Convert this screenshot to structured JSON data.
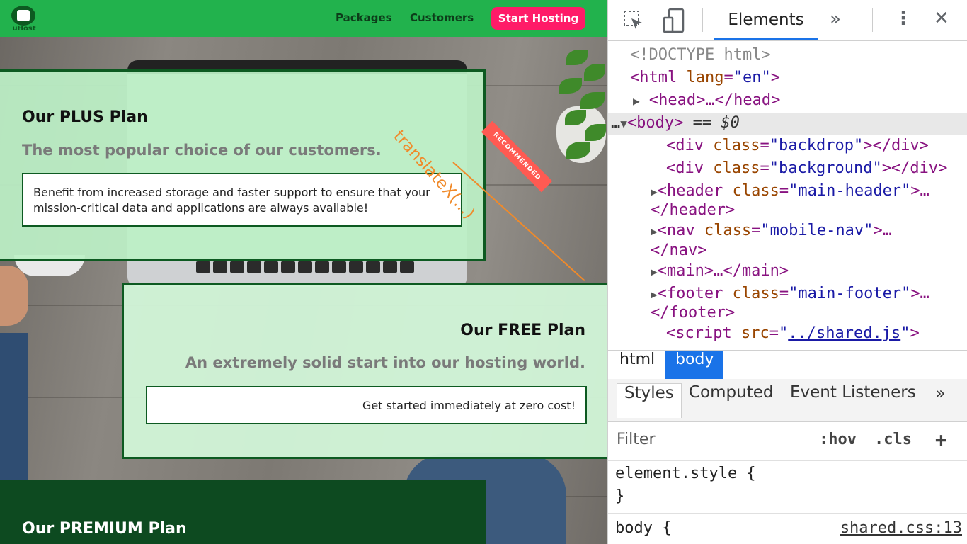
{
  "site": {
    "logo_text": "uHost",
    "nav": {
      "packages": "Packages",
      "customers": "Customers",
      "cta": "Start Hosting"
    },
    "plans": {
      "plus": {
        "title": "Our PLUS Plan",
        "subtitle": "The most popular choice of our customers.",
        "description": "Benefit from increased storage and faster support to ensure that your mission-critical data and applications are always available!",
        "badge": "RECOMMENDED"
      },
      "free": {
        "title": "Our FREE Plan",
        "subtitle": "An extremely solid start into our hosting world.",
        "description": "Get started immediately at zero cost!"
      },
      "premium": {
        "title": "Our PREMIUM Plan"
      }
    },
    "annotation": "translateX(...)",
    "annotation_color": "#f08a2a",
    "brand_color": "#22b24d",
    "cta_color": "#ff1b68"
  },
  "devtools": {
    "toolbar": {
      "inspect_icon": "inspect-cursor-icon",
      "device_icon": "device-toggle-icon",
      "active_tab": "Elements",
      "more_tabs": "»",
      "menu": "⋮",
      "close": "✕"
    },
    "dom": {
      "doctype": "<!DOCTYPE html>",
      "html_open": {
        "tag": "html",
        "attr": "lang",
        "val": "en"
      },
      "head": "<head>…</head>",
      "body_marker": "== $0",
      "backdrop": {
        "tag": "div",
        "attr": "class",
        "val": "backdrop"
      },
      "background": {
        "tag": "div",
        "attr": "class",
        "val": "background"
      },
      "header": {
        "tag": "header",
        "attr": "class",
        "val": "main-header",
        "close": "</header>"
      },
      "nav": {
        "tag": "nav",
        "attr": "class",
        "val": "mobile-nav",
        "close": "</nav>"
      },
      "main": "<main>…</main>",
      "footer": {
        "tag": "footer",
        "attr": "class",
        "val": "main-footer",
        "close": "</footer>"
      },
      "script": {
        "tag": "script",
        "attr": "src",
        "val": "../shared.js"
      }
    },
    "breadcrumbs": [
      "html",
      "body"
    ],
    "styles_tabs": [
      "Styles",
      "Computed",
      "Event Listeners"
    ],
    "filter": {
      "placeholder": "Filter",
      "hov": ":hov",
      "cls": ".cls",
      "add": "+"
    },
    "rules": {
      "element_style": "element.style {",
      "close_brace": "}",
      "body": "body {",
      "body_source": "shared.css:13"
    }
  }
}
